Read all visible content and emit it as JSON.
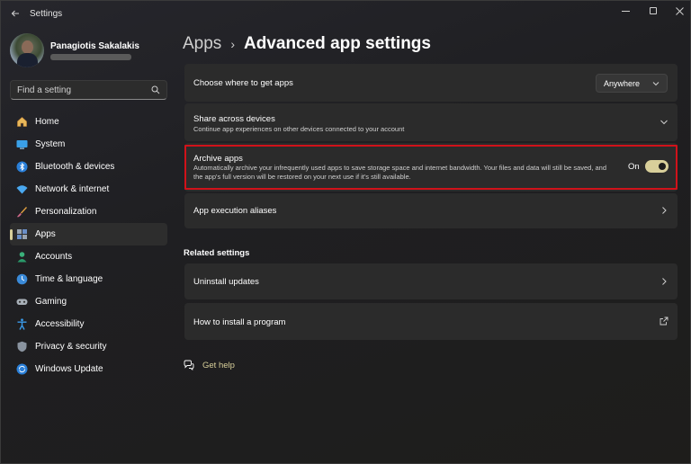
{
  "window": {
    "title": "Settings"
  },
  "profile": {
    "name": "Panagiotis Sakalakis"
  },
  "search": {
    "placeholder": "Find a setting"
  },
  "sidebar": {
    "items": [
      {
        "label": "Home",
        "icon": "home-icon",
        "active": false
      },
      {
        "label": "System",
        "icon": "system-icon",
        "active": false
      },
      {
        "label": "Bluetooth & devices",
        "icon": "bluetooth-icon",
        "active": false
      },
      {
        "label": "Network & internet",
        "icon": "network-icon",
        "active": false
      },
      {
        "label": "Personalization",
        "icon": "brush-icon",
        "active": false
      },
      {
        "label": "Apps",
        "icon": "apps-icon",
        "active": true
      },
      {
        "label": "Accounts",
        "icon": "accounts-icon",
        "active": false
      },
      {
        "label": "Time & language",
        "icon": "globe-clock-icon",
        "active": false
      },
      {
        "label": "Gaming",
        "icon": "gamepad-icon",
        "active": false
      },
      {
        "label": "Accessibility",
        "icon": "accessibility-icon",
        "active": false
      },
      {
        "label": "Privacy & security",
        "icon": "shield-icon",
        "active": false
      },
      {
        "label": "Windows Update",
        "icon": "update-icon",
        "active": false
      }
    ]
  },
  "breadcrumb": {
    "parent": "Apps",
    "separator": "›",
    "current": "Advanced app settings"
  },
  "settings": {
    "get_apps": {
      "title": "Choose where to get apps",
      "value": "Anywhere"
    },
    "share": {
      "title": "Share across devices",
      "description": "Continue app experiences on other devices connected to your account"
    },
    "archive": {
      "title": "Archive apps",
      "description_line1": "Automatically archive your infrequently used apps to save storage space and internet bandwidth. Your files and data will still be saved, and",
      "description_line2": "the app's full version will be restored on your next use if it's still available.",
      "state_label": "On",
      "enabled": true
    },
    "aliases": {
      "title": "App execution aliases"
    }
  },
  "related": {
    "heading": "Related settings",
    "uninstall": {
      "title": "Uninstall updates"
    },
    "install": {
      "title": "How to install a program"
    }
  },
  "help": {
    "label": "Get help"
  },
  "colors": {
    "accent": "#d8cf9a",
    "highlight_border": "#d0121a",
    "card_bg": "#2b2b2b"
  }
}
